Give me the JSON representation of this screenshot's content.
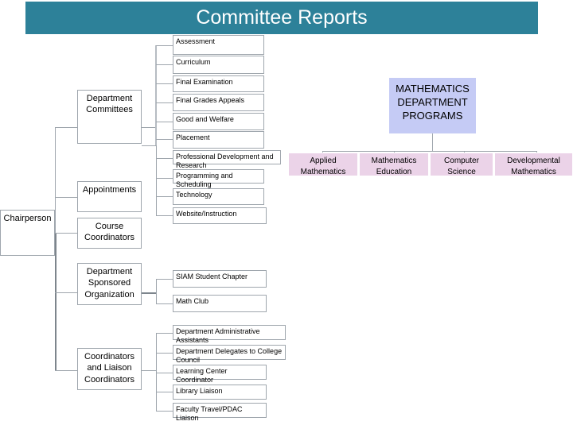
{
  "title": {
    "text": "Committee Reports",
    "bar_color": "#2D8199",
    "text_color": "#ffffff"
  },
  "org_chart": {
    "root": {
      "label": "Chairperson"
    },
    "branches": [
      {
        "label": "Department Committees"
      },
      {
        "label": "Appointments"
      },
      {
        "label": "Course Coordinators"
      },
      {
        "label": "Department Sponsored Organization"
      },
      {
        "label": "Coordinators and Liaison Coordinators"
      }
    ],
    "committees": [
      {
        "label": "Assessment"
      },
      {
        "label": "Curriculum"
      },
      {
        "label": "Final Examination"
      },
      {
        "label": "Final Grades Appeals"
      },
      {
        "label": "Good and Welfare"
      },
      {
        "label": "Placement"
      },
      {
        "label": "Professional Development and Research"
      },
      {
        "label": "Programming and Scheduling"
      },
      {
        "label": "Technology"
      },
      {
        "label": "Website/Instruction"
      }
    ],
    "organizations": [
      {
        "label": "SIAM Student Chapter"
      },
      {
        "label": "Math Club"
      }
    ],
    "coordinators": [
      {
        "label": "Department Administrative Assistants"
      },
      {
        "label": "Department Delegates to College Council"
      },
      {
        "label": "Learning Center Coordinator"
      },
      {
        "label": "Library Liaison"
      },
      {
        "label": "Faculty Travel/PDAC Liaison"
      }
    ]
  },
  "programs_chart": {
    "head": {
      "label": "MATHEMATICS DEPARTMENT PROGRAMS",
      "color": "#C5CBF5"
    },
    "items": [
      {
        "label": "Applied Mathematics",
        "color": "#EBD3E8"
      },
      {
        "label": "Mathematics Education",
        "color": "#EBD3E8"
      },
      {
        "label": "Computer Science",
        "color": "#EBD3E8"
      },
      {
        "label": "Developmental Mathematics",
        "color": "#EBD3E8"
      }
    ]
  }
}
